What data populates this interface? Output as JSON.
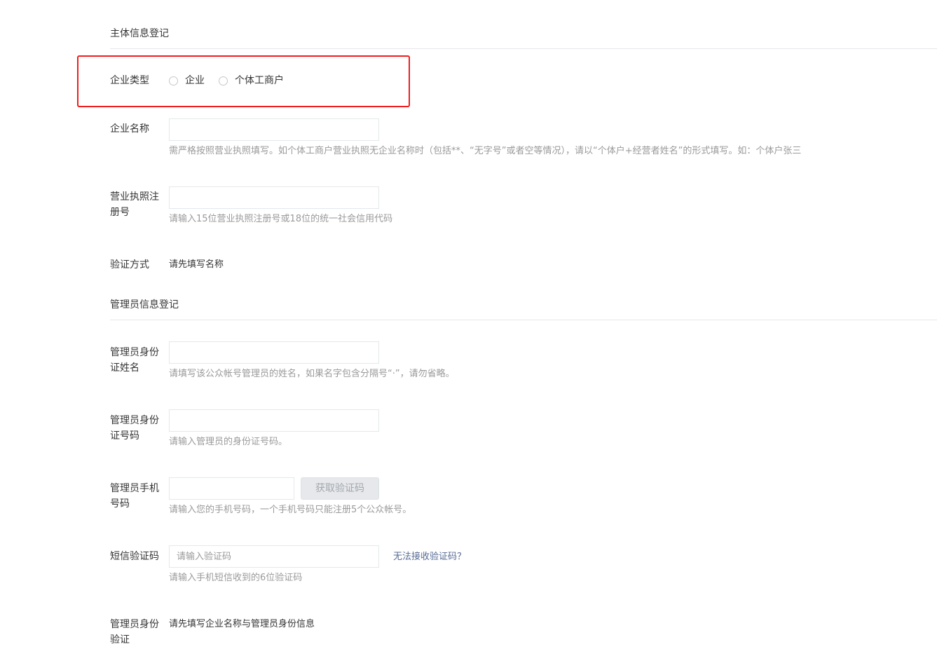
{
  "subject_section": {
    "title": "主体信息登记",
    "company_type_label": "企业类型",
    "company_type_options": [
      "企业",
      "个体工商户"
    ],
    "company_name_label": "企业名称",
    "company_name_value": "",
    "company_name_tip": "需严格按照营业执照填写。如个体工商户营业执照无企业名称时（包括**、“无字号”或者空等情况），请以“个体户+经营者姓名”的形式填写。如：个体户张三",
    "license_label": "营业执照注册号",
    "license_value": "",
    "license_tip": "请输入15位营业执照注册号或18位的统一社会信用代码",
    "verify_method_label": "验证方式",
    "verify_method_value": "请先填写名称"
  },
  "admin_section": {
    "title": "管理员信息登记",
    "id_name_label": "管理员身份证姓名",
    "id_name_value": "",
    "id_name_tip": "请填写该公众帐号管理员的姓名，如果名字包含分隔号“·”，请勿省略。",
    "id_number_label": "管理员身份证号码",
    "id_number_value": "",
    "id_number_tip": "请输入管理员的身份证号码。",
    "phone_label": "管理员手机号码",
    "phone_value": "",
    "get_code_button": "获取验证码",
    "phone_tip": "请输入您的手机号码，一个手机号码只能注册5个公众帐号。",
    "sms_label": "短信验证码",
    "sms_placeholder": "请输入验证码",
    "sms_value": "",
    "sms_link": "无法接收验证码？",
    "sms_tip": "请输入手机短信收到的6位验证码",
    "id_verify_label": "管理员身份验证",
    "id_verify_value": "请先填写企业名称与管理员身份信息"
  },
  "colors": {
    "highlight": "#f01e1e",
    "link": "#576b95",
    "tip": "#9a9a9a",
    "divider": "#e7e7eb"
  }
}
